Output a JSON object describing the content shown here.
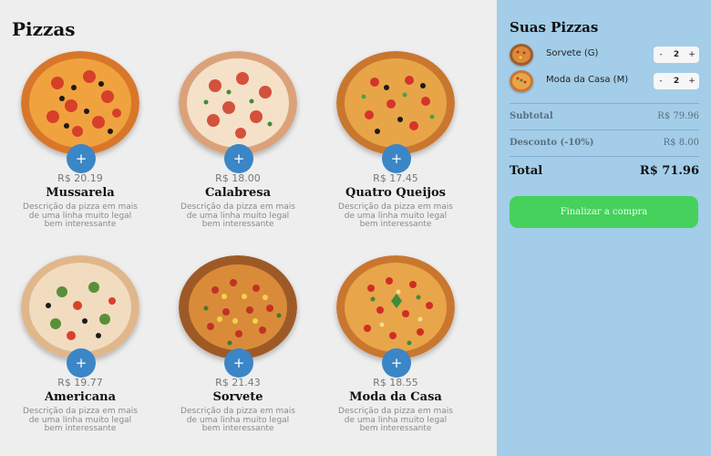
{
  "catalog": {
    "title": "Pizzas",
    "add_label": "+",
    "pizzas": [
      {
        "name": "Mussarela",
        "price": "R$ 20.19",
        "description": "Descrição da pizza em mais de uma linha muito legal bem interessante"
      },
      {
        "name": "Calabresa",
        "price": "R$ 18.00",
        "description": "Descrição da pizza em mais de uma linha muito legal bem interessante"
      },
      {
        "name": "Quatro Queijos",
        "price": "R$ 17.45",
        "description": "Descrição da pizza em mais de uma linha muito legal bem interessante"
      },
      {
        "name": "Americana",
        "price": "R$ 19.77",
        "description": "Descrição da pizza em mais de uma linha muito legal bem interessante"
      },
      {
        "name": "Sorvete",
        "price": "R$ 21.43",
        "description": "Descrição da pizza em mais de uma linha muito legal bem interessante"
      },
      {
        "name": "Moda da Casa",
        "price": "R$ 18.55",
        "description": "Descrição da pizza em mais de uma linha muito legal bem interessante"
      }
    ]
  },
  "cart": {
    "title": "Suas Pizzas",
    "items": [
      {
        "name": "Sorvete (G)",
        "quantity": "2",
        "minus": "-",
        "plus": "+"
      },
      {
        "name": "Moda da Casa (M)",
        "quantity": "2",
        "minus": "-",
        "plus": "+"
      }
    ],
    "subtotal_label": "Subtotal",
    "subtotal_value": "R$ 79.96",
    "discount_label": "Desconto (-10%)",
    "discount_value": "R$ 8.00",
    "total_label": "Total",
    "total_value": "R$ 71.96",
    "checkout_label": "Finalizar a compra"
  },
  "colors": {
    "add_button": "#3b86c6",
    "cart_background": "#a3cde8",
    "checkout_button": "#45d15b"
  }
}
